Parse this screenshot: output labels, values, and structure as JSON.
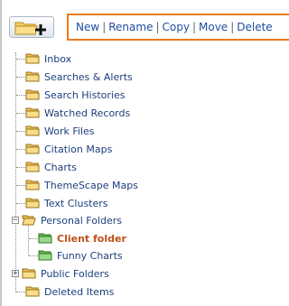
{
  "toolbar": {
    "new_folder_icon": "folder-plus-icon",
    "actions": [
      {
        "label": "New"
      },
      {
        "label": "Rename"
      },
      {
        "label": "Copy"
      },
      {
        "label": "Move"
      },
      {
        "label": "Delete"
      }
    ],
    "separator": "|",
    "accent_color": "#ea7a1e"
  },
  "tree": {
    "items": [
      {
        "label": "Inbox"
      },
      {
        "label": "Searches & Alerts"
      },
      {
        "label": "Search Histories"
      },
      {
        "label": "Watched Records"
      },
      {
        "label": "Work Files"
      },
      {
        "label": "Citation Maps"
      },
      {
        "label": "Charts"
      },
      {
        "label": "ThemeScape Maps"
      },
      {
        "label": "Text Clusters"
      },
      {
        "label": "Personal Folders",
        "expanded": true,
        "toggle": "−"
      },
      {
        "label": "Client folder",
        "selected": true
      },
      {
        "label": "Funny Charts"
      },
      {
        "label": "Public Folders",
        "expanded": false,
        "toggle": "+"
      },
      {
        "label": "Deleted Items"
      }
    ],
    "folder_color": "#e8b84a",
    "child_folder_color": "#6ec35a",
    "selected_color": "#c0501a"
  }
}
